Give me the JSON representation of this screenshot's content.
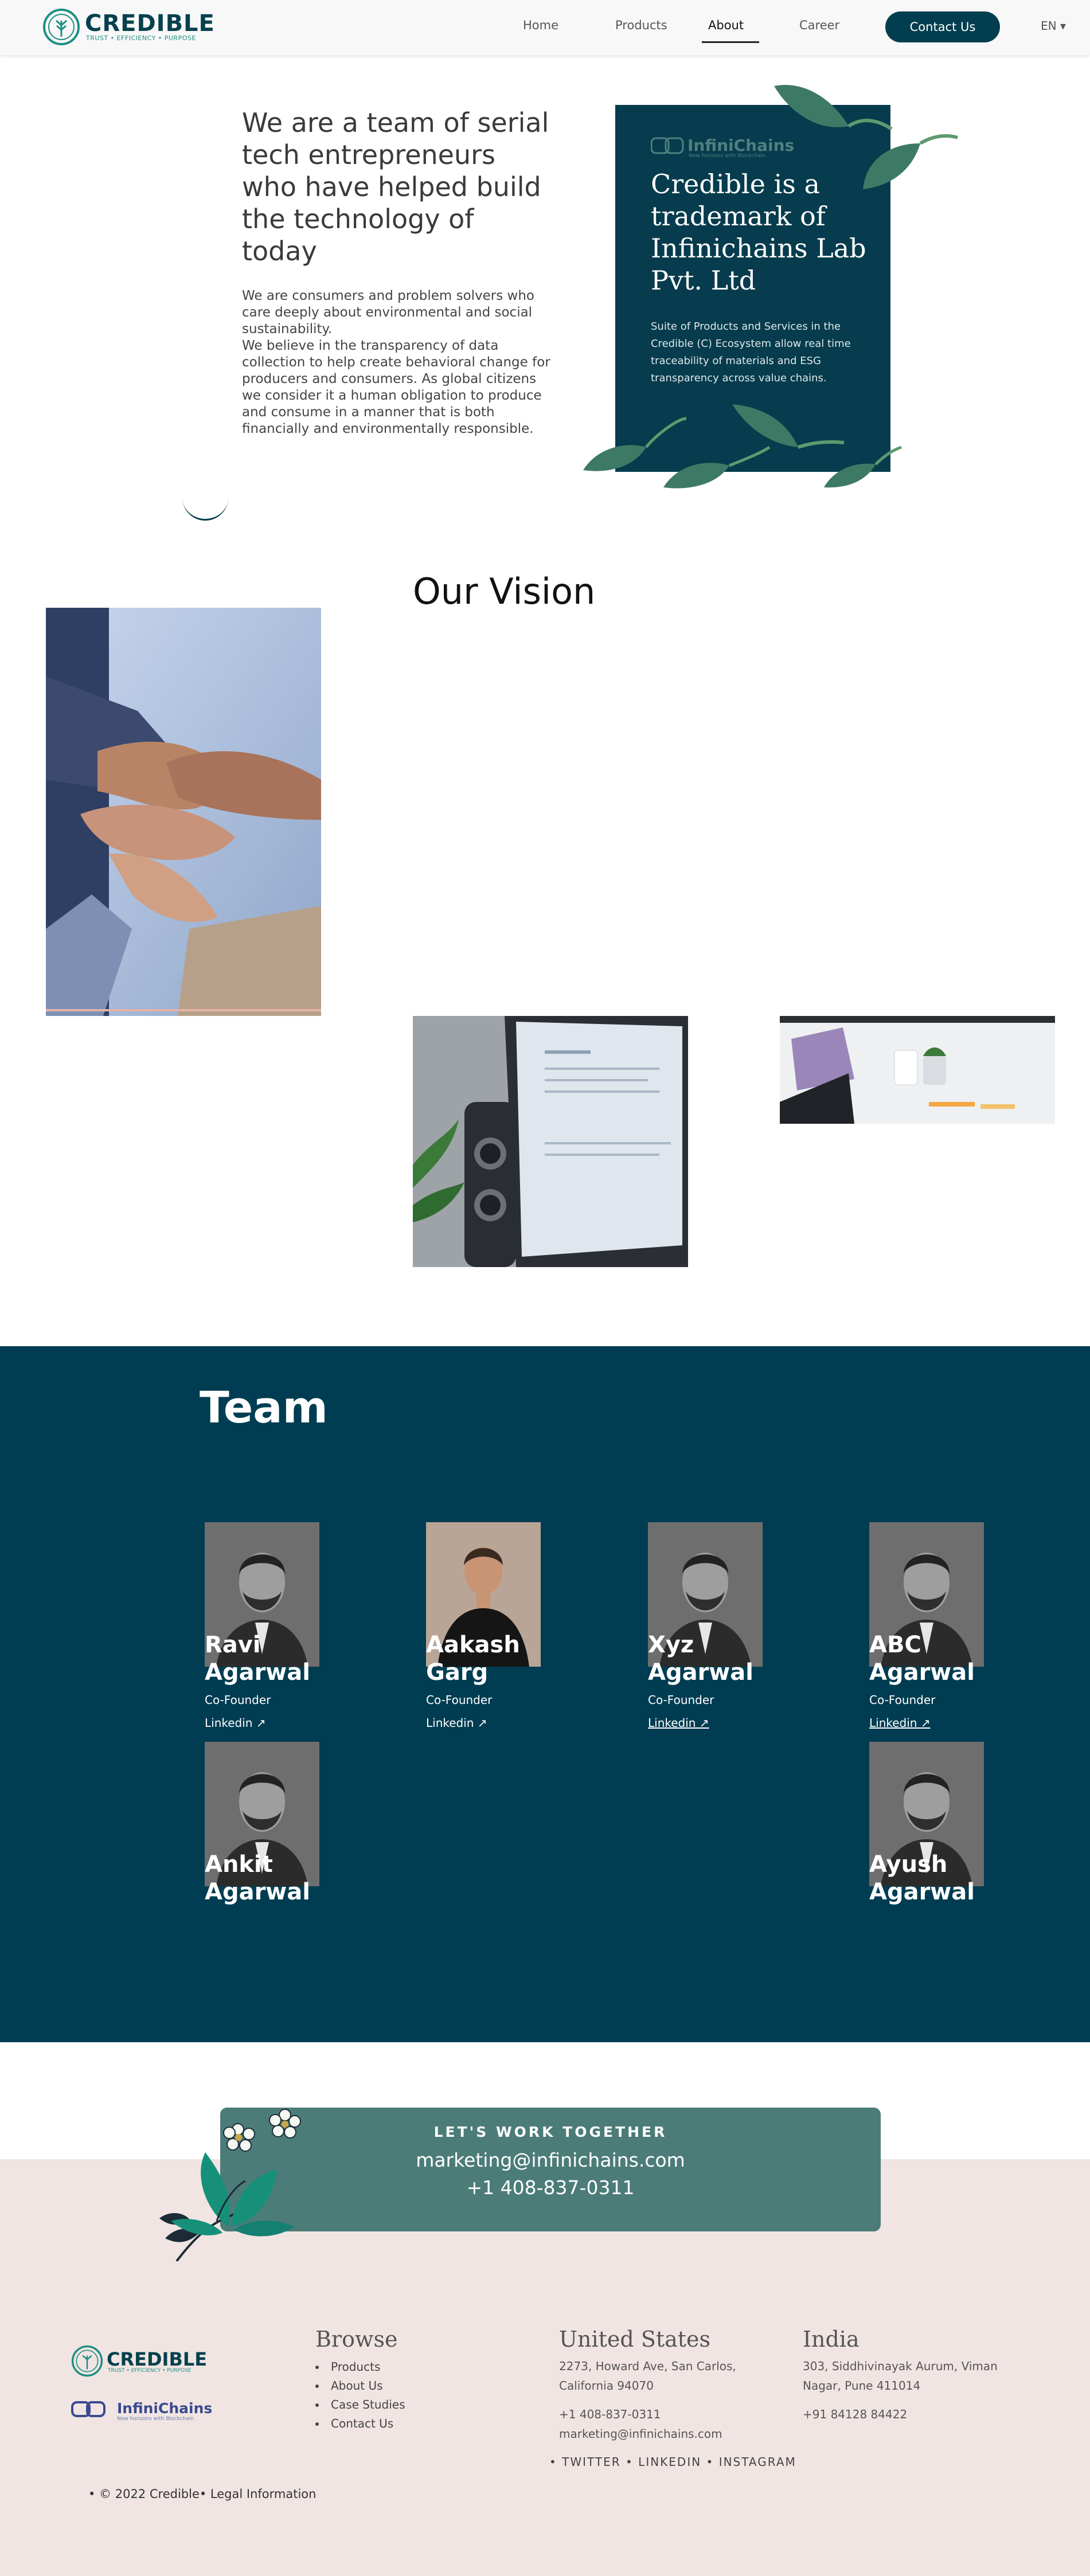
{
  "brand": {
    "name": "CREDIBLE",
    "tagline": "TRUST • EFFICIENCY • PURPOSE",
    "colors": {
      "primary": "#023e4f",
      "teal": "#1d8f84",
      "cta": "#4c7c78",
      "footer_bg": "#f0e5e2",
      "leaf": "#3d7a65"
    }
  },
  "nav": {
    "items": [
      "Home",
      "Products",
      "About",
      "Career"
    ],
    "active": "About",
    "contact_label": "Contact Us",
    "language": "EN ▾"
  },
  "hero": {
    "title": "We are a team of serial tech entrepreneurs who have helped build the technology of today",
    "para1": "We are consumers and problem solvers who care deeply about environmental and social sustainability.",
    "para2": "We believe in the transparency of data collection to help create behavioral change for producers and consumers. As global citizens we consider it a human obligation to produce and consume in a manner that is both financially and environmentally responsible."
  },
  "card": {
    "logo_text": "InfiniChains",
    "logo_sub": "New horizons with Blockchain",
    "title": "Credible is a trademark of Infinichains Lab Pvt. Ltd",
    "text": "Suite of Products and Services in the Credible (C) Ecosystem allow real time traceability of materials and ESG transparency across value chains."
  },
  "vision": {
    "title": "Our Vision"
  },
  "team": {
    "title": "Team",
    "members": [
      {
        "name": "Ravi Agarwal",
        "role": "Co-Founder",
        "link": "Linkedin ↗"
      },
      {
        "name": "Aakash Garg",
        "role": "Co-Founder",
        "link": "Linkedin ↗"
      },
      {
        "name": "Xyz Agarwal",
        "role": "Co-Founder",
        "link": "Linkedin ↗"
      },
      {
        "name": "ABC Agarwal",
        "role": "Co-Founder",
        "link": "Linkedin ↗"
      },
      {
        "name": "Ankit Agarwal",
        "role": "",
        "link": ""
      },
      {
        "name": "Ayush Agarwal",
        "role": "",
        "link": ""
      }
    ]
  },
  "cta": {
    "kicker": "LET'S WORK TOGETHER",
    "email": "marketing@infinichains.com",
    "phone": "+1 408-837-0311"
  },
  "footer": {
    "logo2_text": "InfiniChains",
    "logo2_sub": "New horizons with Blockchain",
    "browse_title": "Browse",
    "browse_items": [
      "Products",
      "About Us",
      "Case Studies",
      "Contact Us"
    ],
    "us_title": "United States",
    "us_address": "2273, Howard Ave, San Carlos, California 94070",
    "us_phone": "+1 408-837-0311",
    "us_email": "marketing@infinichains.com",
    "india_title": "India",
    "india_address": "303, Siddhivinayak Aurum, Viman Nagar, Pune 411014",
    "india_phone": "+91 84128 84422",
    "social": "• TWITTER • LINKEDIN • INSTAGRAM",
    "copyright": "• © 2022 Credible• Legal Information"
  }
}
